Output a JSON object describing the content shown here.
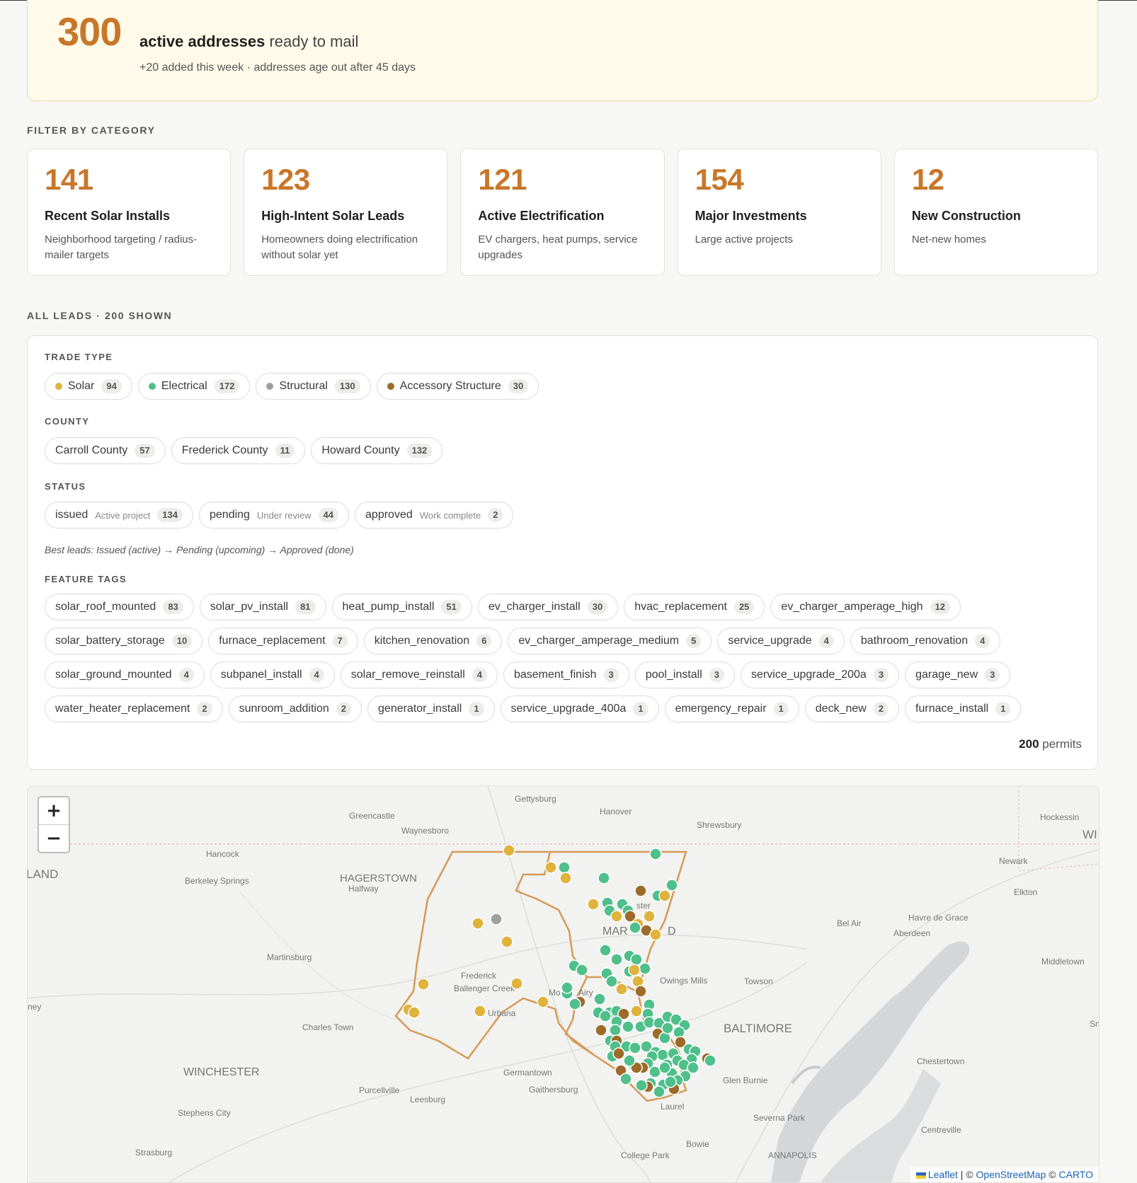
{
  "hero": {
    "count": "300",
    "headline_bold": "active addresses",
    "headline_rest": "ready to mail",
    "sub": "+20 added this week · addresses age out after 45 days"
  },
  "categories": {
    "label": "FILTER BY CATEGORY",
    "items": [
      {
        "count": "141",
        "title": "Recent Solar Installs",
        "desc": "Neighborhood targeting / radius-mailer targets"
      },
      {
        "count": "123",
        "title": "High-Intent Solar Leads",
        "desc": "Homeowners doing electrification without solar yet"
      },
      {
        "count": "121",
        "title": "Active Electrification",
        "desc": "EV chargers, heat pumps, service upgrades"
      },
      {
        "count": "154",
        "title": "Major Investments",
        "desc": "Large active projects"
      },
      {
        "count": "12",
        "title": "New Construction",
        "desc": "Net-new homes"
      }
    ]
  },
  "leads_label": "ALL LEADS · 200 SHOWN",
  "filters": {
    "trade_type": {
      "label": "TRADE TYPE",
      "items": [
        {
          "label": "Solar",
          "count": "94",
          "color": "#dfb33c"
        },
        {
          "label": "Electrical",
          "count": "172",
          "color": "#4fbf8b"
        },
        {
          "label": "Structural",
          "count": "130",
          "color": "#a0a0a0"
        },
        {
          "label": "Accessory Structure",
          "count": "30",
          "color": "#9c6b2b"
        }
      ]
    },
    "county": {
      "label": "COUNTY",
      "items": [
        {
          "label": "Carroll County",
          "count": "57"
        },
        {
          "label": "Frederick County",
          "count": "11"
        },
        {
          "label": "Howard County",
          "count": "132"
        }
      ]
    },
    "status": {
      "label": "STATUS",
      "items": [
        {
          "label": "issued",
          "sublabel": "Active project",
          "count": "134"
        },
        {
          "label": "pending",
          "sublabel": "Under review",
          "count": "44"
        },
        {
          "label": "approved",
          "sublabel": "Work complete",
          "count": "2"
        }
      ],
      "hint": "Best leads: Issued (active) → Pending (upcoming) → Approved (done)"
    },
    "feature_tags": {
      "label": "FEATURE TAGS",
      "items": [
        {
          "label": "solar_roof_mounted",
          "count": "83"
        },
        {
          "label": "solar_pv_install",
          "count": "81"
        },
        {
          "label": "heat_pump_install",
          "count": "51"
        },
        {
          "label": "ev_charger_install",
          "count": "30"
        },
        {
          "label": "hvac_replacement",
          "count": "25"
        },
        {
          "label": "ev_charger_amperage_high",
          "count": "12"
        },
        {
          "label": "solar_battery_storage",
          "count": "10"
        },
        {
          "label": "furnace_replacement",
          "count": "7"
        },
        {
          "label": "kitchen_renovation",
          "count": "6"
        },
        {
          "label": "ev_charger_amperage_medium",
          "count": "5"
        },
        {
          "label": "service_upgrade",
          "count": "4"
        },
        {
          "label": "bathroom_renovation",
          "count": "4"
        },
        {
          "label": "solar_ground_mounted",
          "count": "4"
        },
        {
          "label": "subpanel_install",
          "count": "4"
        },
        {
          "label": "solar_remove_reinstall",
          "count": "4"
        },
        {
          "label": "basement_finish",
          "count": "3"
        },
        {
          "label": "pool_install",
          "count": "3"
        },
        {
          "label": "service_upgrade_200a",
          "count": "3"
        },
        {
          "label": "garage_new",
          "count": "3"
        },
        {
          "label": "water_heater_replacement",
          "count": "2"
        },
        {
          "label": "sunroom_addition",
          "count": "2"
        },
        {
          "label": "generator_install",
          "count": "1"
        },
        {
          "label": "service_upgrade_400a",
          "count": "1"
        },
        {
          "label": "emergency_repair",
          "count": "1"
        },
        {
          "label": "deck_new",
          "count": "2"
        },
        {
          "label": "furnace_install",
          "count": "1"
        }
      ]
    },
    "permits_count": "200",
    "permits_label": "permits"
  },
  "map": {
    "zoom_in": "+",
    "zoom_out": "−",
    "place_labels": [
      "Gettysburg",
      "Hanover",
      "Greencastle",
      "Waynesboro",
      "Shrewsbury",
      "Hockessin",
      "WI",
      "Hancock",
      "LAND",
      "Berkeley Springs",
      "HAGERSTOWN",
      "Halfway",
      "Newark",
      "Elkton",
      "Bel Air",
      "Havre de Grace",
      "Aberdeen",
      "MAR",
      "D",
      "ster",
      "Martinsburg",
      "Frederick",
      "Ballenger Creek",
      "Urbana",
      "Mo",
      "Airy",
      "Owings Mills",
      "Towson",
      "Middletown",
      "BALTIMORE",
      "ney",
      "Charles Town",
      "Sn",
      "WINCHESTER",
      "Germantown",
      "Chestertown",
      "Glen Burnie",
      "Purcellville",
      "Gaithersburg",
      "Leesburg",
      "Stephens City",
      "Laurel",
      "Severna Park",
      "Centreville",
      "Strasburg",
      "Bowie",
      "College Park",
      "ANNAPOLIS"
    ],
    "attribution": {
      "leaflet": "Leaflet",
      "sep": "|",
      "copy1": "©",
      "osm": "OpenStreetMap",
      "copy2": "©",
      "carto": "CARTO"
    }
  }
}
